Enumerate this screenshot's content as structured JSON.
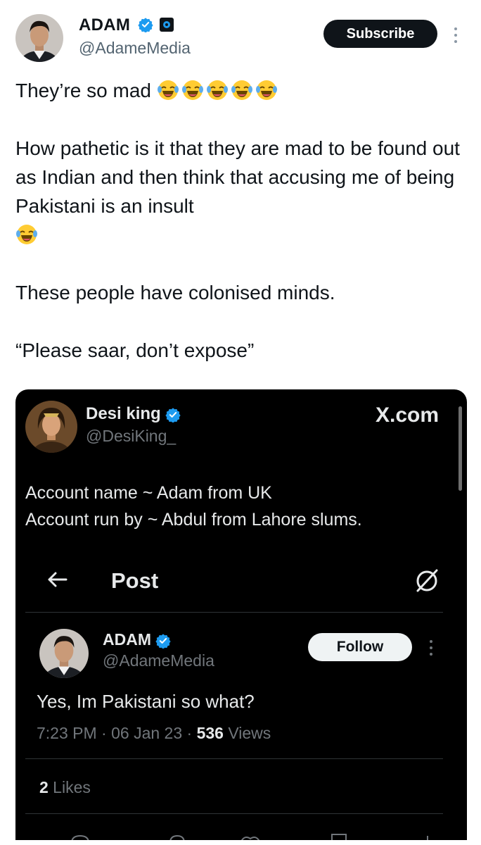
{
  "outer_tweet": {
    "author": {
      "name": "ADAM",
      "handle": "@AdameMedia"
    },
    "subscribe_label": "Subscribe",
    "paragraphs": [
      "They’re so mad",
      "How pathetic is it that they are mad to be found out as Indian and then think that accusing me of being Pakistani is an insult",
      "These people have colonised minds.",
      "“Please saar, don’t expose”"
    ]
  },
  "embedded": {
    "author": {
      "name": "Desi king",
      "handle": "@DesiKing_"
    },
    "watermark": "X.com",
    "lines": [
      "Account name ~ Adam from UK",
      "Account run by ~ Abdul from Lahore slums."
    ],
    "post_header": {
      "title": "Post"
    },
    "quoted": {
      "name": "ADAM",
      "handle": "@AdameMedia",
      "follow_label": "Follow",
      "text": "Yes, Im Pakistani so what?",
      "time": "7:23 PM · 06 Jan 23 · ",
      "views_count": "536",
      "views_label": " Views",
      "likes_count": "2",
      "likes_label": " Likes"
    }
  },
  "colors": {
    "verified_blue": "#1d9bf0",
    "dark_bg": "#000000",
    "subscribe_bg": "#0f1419"
  },
  "icons": [
    "verified-badge-icon",
    "affiliate-badge-icon",
    "more-icon",
    "back-arrow-icon",
    "grok-icon",
    "laughing-emoji-icon"
  ]
}
